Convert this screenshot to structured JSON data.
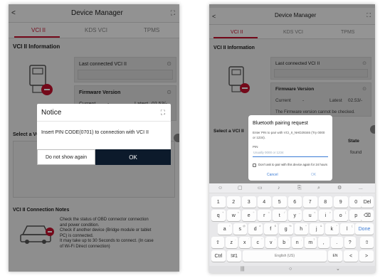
{
  "left": {
    "title": "Device Manager",
    "back": "<",
    "tabs": [
      "VCI II",
      "KDS VCI",
      "TPMS"
    ],
    "section_title": "VCI II Information",
    "last_connected_label": "Last connected VCI II",
    "firmware_label": "Firmware Version",
    "current_label": "Current",
    "current_value": "-",
    "latest_label": "Latest",
    "latest_value": "02.53/-",
    "select_label": "Select a VCI II",
    "connection_notes_title": "VCI II Connection Notes",
    "notes": [
      "Check the status of OBD connector connection",
      "and power condition.",
      "Check if another device (Bridge module or tablet",
      "PC) is connected.",
      "It may take up to 30 Seconds to connect. (In case",
      "of Wi-Fi Direct connection)"
    ],
    "dialog": {
      "title": "Notice",
      "message": "Insert PIN CODE(0701) to connection with VCI II",
      "secondary_button": "Do not show again",
      "primary_button": "OK"
    }
  },
  "right": {
    "title": "Device Manager",
    "back": "<",
    "tabs": [
      "VCI II",
      "KDS VCI",
      "TPMS"
    ],
    "section_title": "VCI II Information",
    "last_connected_label": "Last connected VCI II",
    "firmware_label": "Firmware Version",
    "current_label": "Current",
    "current_value": "-",
    "latest_label": "Latest",
    "latest_value": "02.53/-",
    "firmware_note": "The Firmware version cannot be checked.",
    "select_label": "Select a VCI II",
    "state_label": "State",
    "found_label": "found",
    "dialog": {
      "title": "Bluetooth pairing request",
      "message_line1": "Enter PIN to pair with VCI_II_NHD29346 (Try 0000",
      "message_line2": "or 1234).",
      "pin_label": "PIN",
      "pin_placeholder": "Usually 0000 or 1234",
      "checkbox_label": "Don't ask to pair with this device again for 24 hours",
      "cancel": "Cancel",
      "ok": "OK"
    },
    "keyboard": {
      "toolbar_more": "...",
      "row1": [
        "1",
        "2",
        "3",
        "4",
        "5",
        "6",
        "7",
        "8",
        "9",
        "0"
      ],
      "row1_extra": "Del",
      "row2": [
        "q",
        "w",
        "e",
        "r",
        "t",
        "y",
        "u",
        "i",
        "o",
        "p"
      ],
      "row2_sup": [
        "+",
        "×",
        "÷",
        "=",
        "/",
        "_",
        "<",
        ">",
        "[",
        "]"
      ],
      "row3": [
        "a",
        "s",
        "d",
        "f",
        "g",
        "h",
        "j",
        "k",
        "l"
      ],
      "row3_sup": [
        "!",
        "@",
        "#",
        "$",
        "%",
        "^",
        "&",
        "*",
        "("
      ],
      "row3_extra": "Done",
      "row4": [
        "z",
        "x",
        "c",
        "v",
        "b",
        "n",
        "m",
        ",",
        ".",
        "?"
      ],
      "row4_sup": [
        "-",
        "'",
        "\"",
        ":",
        ";",
        ",",
        "?",
        "",
        "",
        ""
      ],
      "ctrl": "Ctrl",
      "sym": "!#1",
      "space": "English (US)",
      "lang": "EN"
    }
  }
}
